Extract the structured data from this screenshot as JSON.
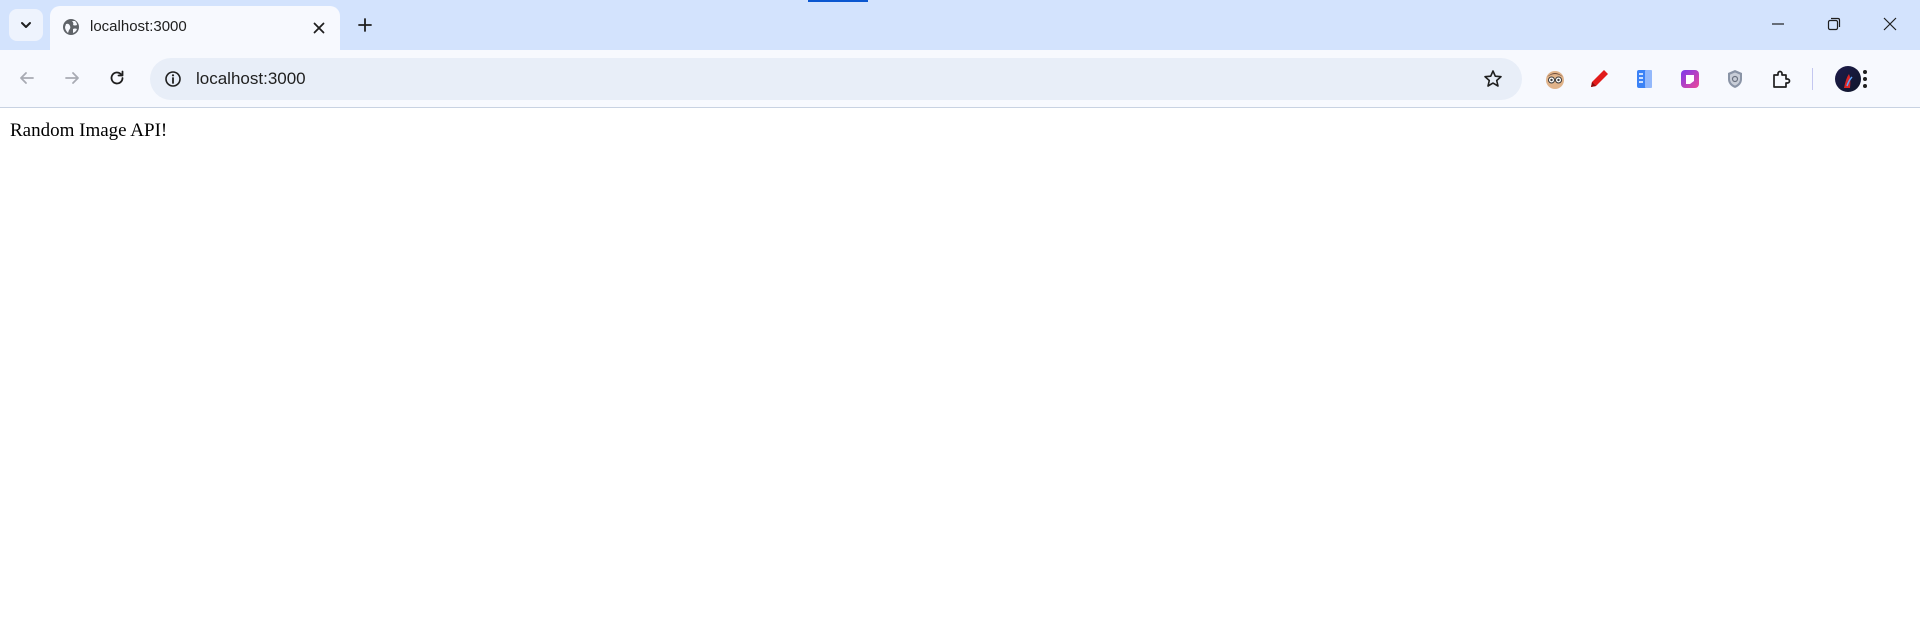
{
  "browser": {
    "tab": {
      "title": "localhost:3000"
    },
    "omnibox": {
      "url": "localhost:3000"
    },
    "accent_color": "#0b57d0",
    "tabstrip_color": "#d3e3fd",
    "toolbar_color": "#f7f9fe",
    "icons": {
      "tab_search": "chevron-down-icon",
      "favicon": "globe-icon",
      "tab_close": "close-icon",
      "new_tab": "plus-icon",
      "minimize": "minimize-icon",
      "restore": "restore-icon",
      "close_window": "close-icon",
      "back": "arrow-left-icon",
      "forward": "arrow-right-icon",
      "reload": "reload-icon",
      "site_info": "info-icon",
      "bookmark": "star-icon",
      "extensions": [
        "character-face-icon",
        "red-pen-icon",
        "blue-notebook-icon",
        "purple-app-icon",
        "shield-icon",
        "puzzle-icon"
      ],
      "profile": "avatar-icon",
      "menu": "kebab-menu-icon"
    }
  },
  "page": {
    "text": "Random Image API!"
  }
}
